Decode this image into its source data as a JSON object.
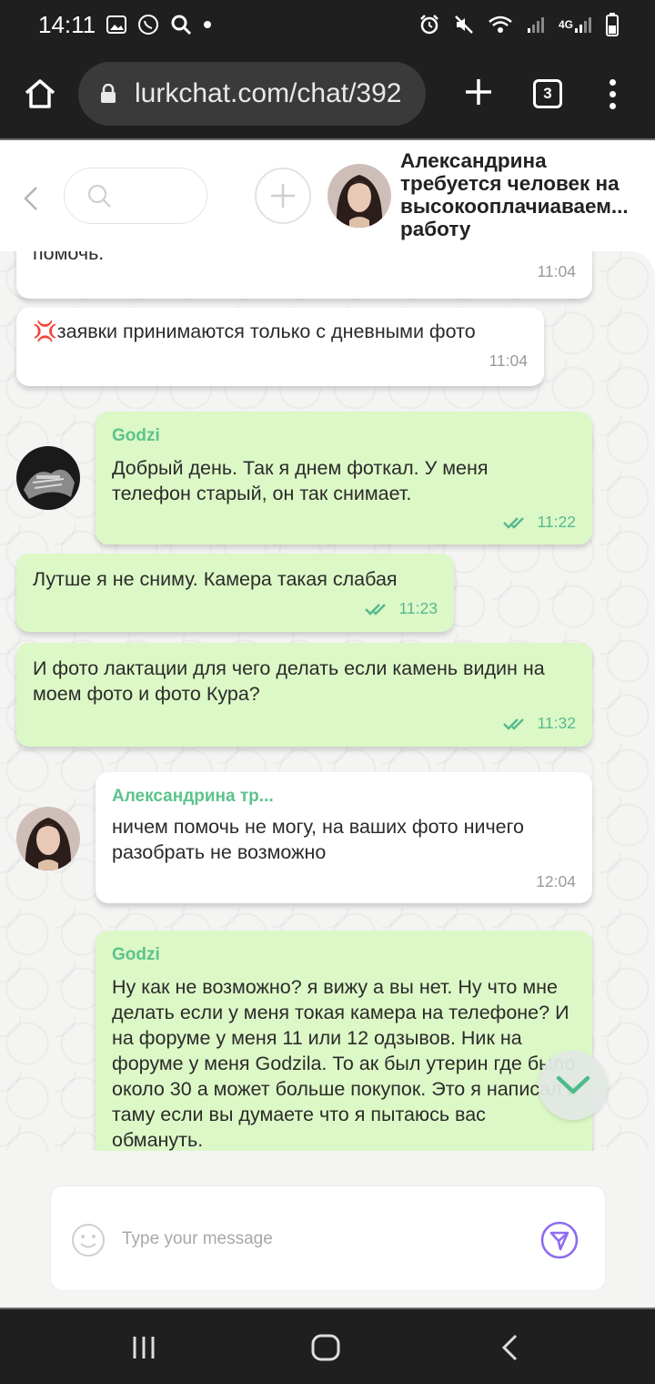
{
  "status_bar": {
    "time": "14:11",
    "network_label": "4G",
    "left_icons": [
      "image-icon",
      "whatsapp-icon",
      "search-icon",
      "dot-icon"
    ],
    "right_icons": [
      "alarm-icon",
      "mute-icon",
      "wifi-icon",
      "signal-icon",
      "signal-icon",
      "battery-icon"
    ]
  },
  "browser": {
    "url": "lurkchat.com/chat/392",
    "tab_count": "3"
  },
  "chat_header": {
    "title": "Александрина требуется человек на высокооплачиаваем... работу"
  },
  "messages": [
    {
      "direction": "in",
      "sender": "",
      "text": "помочь.",
      "time": "11:04"
    },
    {
      "direction": "in",
      "sender": "",
      "text": "💢заявки принимаются только с дневными фото",
      "time": "11:04"
    },
    {
      "direction": "out",
      "sender": "Godzi",
      "text": "Добрый день. Так я днем фоткал. У меня телефон старый, он так снимает.",
      "time": "11:22"
    },
    {
      "direction": "out",
      "sender": "",
      "text": "Лутше я не сниму. Камера такая слабая",
      "time": "11:23"
    },
    {
      "direction": "out",
      "sender": "",
      "text": "И фото лактации для чего делать если камень видин на моем фото и фото Кура?",
      "time": "11:32"
    },
    {
      "direction": "in",
      "sender": "Александрина тр...",
      "text": "ничем помочь не могу, на ваших фото ничего разобрать не возможно",
      "time": "12:04"
    },
    {
      "direction": "out",
      "sender": "Godzi",
      "text": "Ну как не возможно? я вижу а вы нет. Ну что мне делать если у меня токая камера на телефоне? И на форуме у меня 11 или 12 одзывов. Ник на форуме у меня Godzila. То ак был утерин где было около 30 а может больше покупок. Это я написал к таму если вы думаете что я пытаюсь вас обмануть.",
      "time": ""
    }
  ],
  "composer": {
    "placeholder": "Type your message"
  },
  "colors": {
    "outgoing_bubble": "#dcf8c6",
    "incoming_bubble": "#ffffff",
    "accent": "#5cc38c",
    "send_icon": "#8f6cf0"
  }
}
